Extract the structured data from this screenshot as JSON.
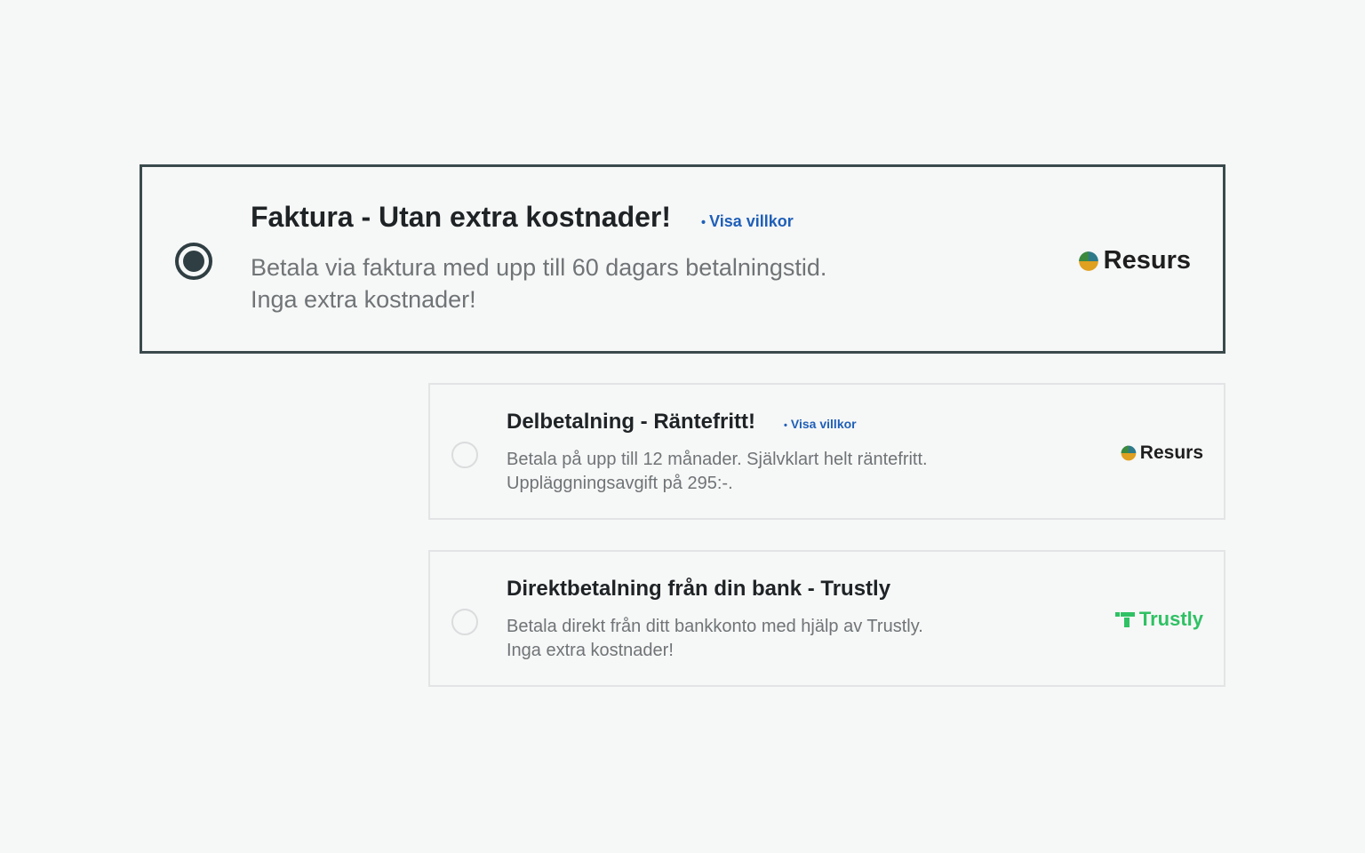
{
  "payment_options": [
    {
      "title": "Faktura - Utan extra kostnader!",
      "terms_link": "Visa villkor",
      "terms_bullet": "•",
      "description_lines": [
        "Betala via faktura med upp till 60 dagars betalningstid.",
        "Inga extra kostnader!"
      ],
      "provider": "Resurs",
      "selected": true
    },
    {
      "title": "Delbetalning - Räntefritt!",
      "terms_link": "Visa villkor",
      "terms_bullet": "•",
      "description_lines": [
        "Betala på upp till 12 månader. Självklart helt räntefritt.",
        "Uppläggningsavgift på 295:-."
      ],
      "provider": "Resurs",
      "selected": false
    },
    {
      "title": "Direktbetalning från din bank - Trustly",
      "description_lines": [
        "Betala direkt från ditt bankkonto med hjälp av Trustly.",
        "Inga extra kostnader!"
      ],
      "provider": "Trustly",
      "selected": false
    }
  ],
  "colors": {
    "background": "#f6f7f7",
    "selected_border": "#3a4a4d",
    "radio_selected": "#2f3e42",
    "link": "#1f5fb8",
    "trustly_green": "#2fc164",
    "muted_text": "#707476"
  },
  "icons": {
    "resurs_logo": "resurs-logo-icon",
    "trustly_logo": "trustly-logo-icon"
  }
}
